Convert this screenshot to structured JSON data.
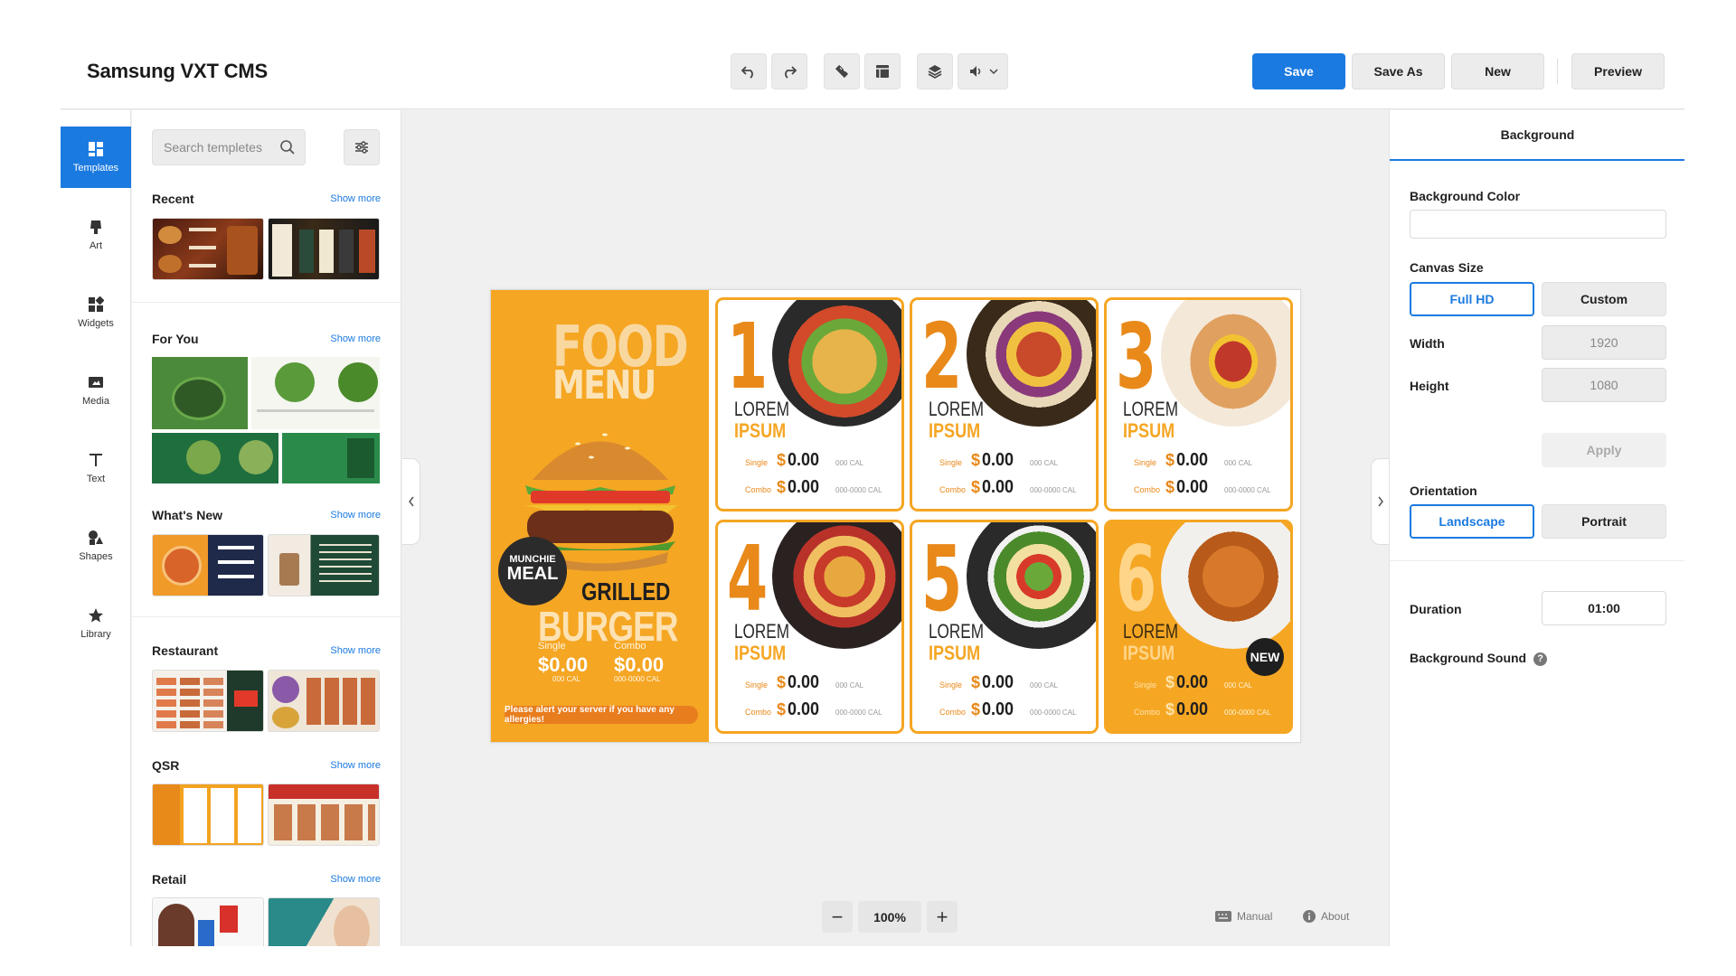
{
  "app": {
    "title": "Samsung VXT CMS"
  },
  "toolbar": {
    "undo_icon": "undo-icon",
    "redo_icon": "redo-icon",
    "ruler_icon": "ruler-icon",
    "grid_icon": "grid-icon",
    "layers_icon": "layers-icon",
    "sound_icon": "speaker-icon",
    "save_label": "Save",
    "save_as_label": "Save As",
    "new_label": "New",
    "preview_label": "Preview"
  },
  "rail": {
    "items": [
      {
        "label": "Templates",
        "icon": "templates-icon",
        "active": true
      },
      {
        "label": "Art",
        "icon": "art-icon"
      },
      {
        "label": "Widgets",
        "icon": "widgets-icon"
      },
      {
        "label": "Media",
        "icon": "media-icon"
      },
      {
        "label": "Text",
        "icon": "text-icon"
      },
      {
        "label": "Shapes",
        "icon": "shapes-icon"
      },
      {
        "label": "Library",
        "icon": "star-icon"
      }
    ]
  },
  "templates": {
    "search_placeholder": "Search templetes",
    "sections": [
      {
        "title": "Recent",
        "more": "Show more"
      },
      {
        "title": "For You",
        "more": "Show more"
      },
      {
        "title": "What's New",
        "more": "Show more"
      },
      {
        "title": "Restaurant",
        "more": "Show more"
      },
      {
        "title": "QSR",
        "more": "Show more"
      },
      {
        "title": "Retail",
        "more": "Show more"
      }
    ]
  },
  "canvas": {
    "menu": {
      "title_line1": "FOOD",
      "title_line2": "MENU",
      "badge_line1": "MUNCHIE",
      "badge_line2": "MEAL",
      "headline1": "GRILLED",
      "headline2": "BURGER",
      "single_label": "Single",
      "combo_label": "Combo",
      "single_price": "$0.00",
      "combo_price": "$0.00",
      "single_cal": "000 CAL",
      "combo_cal": "000-0000 CAL",
      "note": "Please alert your server if you have any allergies!",
      "cards": [
        {
          "num": "1",
          "name1": "LOREM",
          "name2": "IPSUM",
          "single": "Single",
          "combo": "Combo",
          "dollar": "$",
          "sprice": "0.00",
          "cprice": "0.00",
          "scal": "000 CAL",
          "ccal": "000-0000 CAL"
        },
        {
          "num": "2",
          "name1": "LOREM",
          "name2": "IPSUM",
          "single": "Single",
          "combo": "Combo",
          "dollar": "$",
          "sprice": "0.00",
          "cprice": "0.00",
          "scal": "000 CAL",
          "ccal": "000-0000 CAL"
        },
        {
          "num": "3",
          "name1": "LOREM",
          "name2": "IPSUM",
          "single": "Single",
          "combo": "Combo",
          "dollar": "$",
          "sprice": "0.00",
          "cprice": "0.00",
          "scal": "000 CAL",
          "ccal": "000-0000 CAL"
        },
        {
          "num": "4",
          "name1": "LOREM",
          "name2": "IPSUM",
          "single": "Single",
          "combo": "Combo",
          "dollar": "$",
          "sprice": "0.00",
          "cprice": "0.00",
          "scal": "000 CAL",
          "ccal": "000-0000 CAL"
        },
        {
          "num": "5",
          "name1": "LOREM",
          "name2": "IPSUM",
          "single": "Single",
          "combo": "Combo",
          "dollar": "$",
          "sprice": "0.00",
          "cprice": "0.00",
          "scal": "000 CAL",
          "ccal": "000-0000 CAL"
        },
        {
          "num": "6",
          "name1": "LOREM",
          "name2": "IPSUM",
          "single": "Single",
          "combo": "Combo",
          "dollar": "$",
          "sprice": "0.00",
          "cprice": "0.00",
          "scal": "000 CAL",
          "ccal": "000-0000 CAL",
          "badge": "NEW"
        }
      ]
    },
    "zoom": "100%",
    "zoom_out": "−",
    "zoom_in": "+",
    "manual_label": "Manual",
    "about_label": "About"
  },
  "properties": {
    "tab": "Background",
    "background_color_label": "Background Color",
    "background_color_value": "",
    "canvas_size_label": "Canvas Size",
    "size_options": [
      "Full HD",
      "Custom"
    ],
    "width_label": "Width",
    "width_value": "1920",
    "height_label": "Height",
    "height_value": "1080",
    "apply_label": "Apply",
    "orientation_label": "Orientation",
    "orientation_options": [
      "Landscape",
      "Portrait"
    ],
    "duration_label": "Duration",
    "duration_value": "01:00",
    "background_sound_label": "Background Sound",
    "help_glyph": "?"
  },
  "colors": {
    "accent": "#1b7ae0",
    "menu_orange": "#f5a623",
    "menu_dark_orange": "#e8891a"
  }
}
